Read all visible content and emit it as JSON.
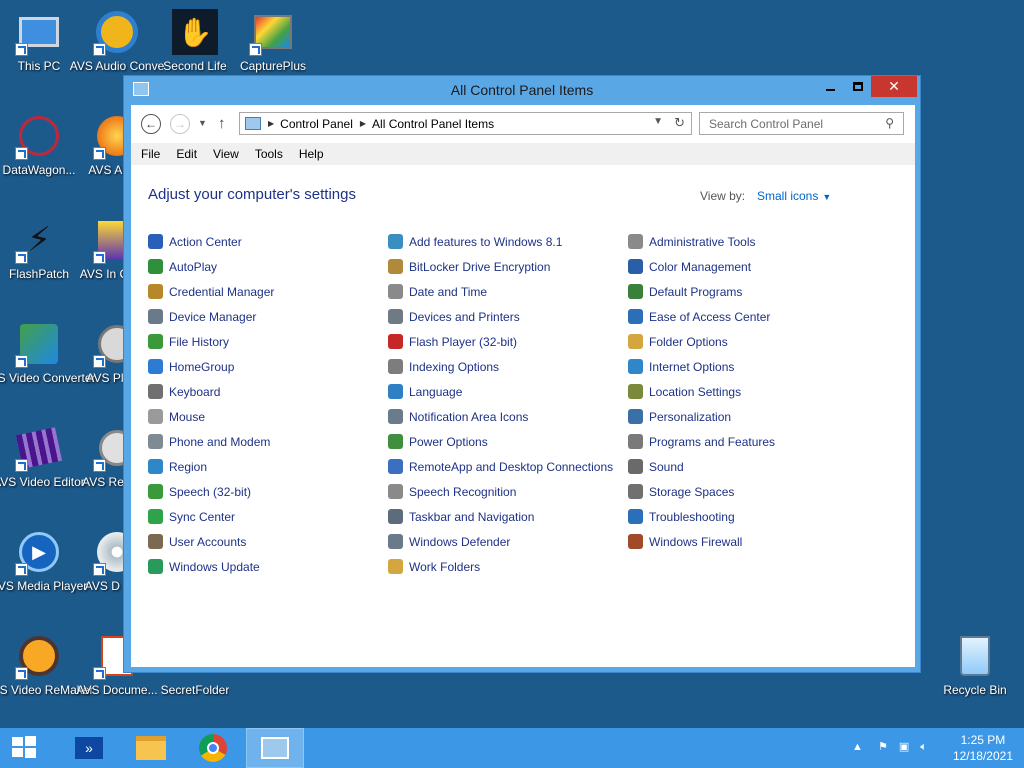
{
  "desktop": {
    "icons": [
      {
        "label": "This PC",
        "icon": "computer-icon"
      },
      {
        "label": "AVS Audio Conve",
        "icon": "avs-audio-converter-icon"
      },
      {
        "label": "Second Life",
        "icon": "second-life-icon"
      },
      {
        "label": "CapturePlus",
        "icon": "captureplus-icon"
      },
      {
        "label": "DataWagon...",
        "icon": "datawagon-icon"
      },
      {
        "label": "AVS A Edit",
        "icon": "avs-audio-editor-icon"
      },
      {
        "label": "FlashPatch",
        "icon": "flashpatch-icon"
      },
      {
        "label": "AVS In Conve",
        "icon": "avs-image-converter-icon"
      },
      {
        "label": "AVS Video Converter",
        "icon": "avs-video-converter-icon"
      },
      {
        "label": "AVS Pl Edit",
        "icon": "avs-photo-editor-icon"
      },
      {
        "label": "AVS Video Editor",
        "icon": "avs-video-editor-icon"
      },
      {
        "label": "AVS Re Clea",
        "icon": "avs-registry-cleaner-icon"
      },
      {
        "label": "AVS Media Player",
        "icon": "avs-media-player-icon"
      },
      {
        "label": "AVS D Crea",
        "icon": "avs-disc-creator-icon"
      },
      {
        "label": "AVS Video ReMaker",
        "icon": "avs-video-remaker-icon"
      },
      {
        "label": "AVS Docume...",
        "icon": "avs-document-converter-icon"
      },
      {
        "label": "SecretFolder",
        "icon": "secretfolder-icon"
      },
      {
        "label": "Recycle Bin",
        "icon": "recycle-bin-icon"
      }
    ]
  },
  "window": {
    "title": "All Control Panel Items",
    "address": [
      "Control Panel",
      "All Control Panel Items"
    ],
    "search_placeholder": "Search Control Panel",
    "menu": [
      "File",
      "Edit",
      "View",
      "Tools",
      "Help"
    ],
    "heading": "Adjust your computer's settings",
    "view_by_label": "View by:",
    "view_by_value": "Small icons",
    "columns": [
      [
        {
          "label": "Action Center",
          "color": "#2a5fb8"
        },
        {
          "label": "AutoPlay",
          "color": "#2f8f3a"
        },
        {
          "label": "Credential Manager",
          "color": "#b8872a"
        },
        {
          "label": "Device Manager",
          "color": "#6b7a8a"
        },
        {
          "label": "File History",
          "color": "#3a9a3a"
        },
        {
          "label": "HomeGroup",
          "color": "#2e7bd3"
        },
        {
          "label": "Keyboard",
          "color": "#707070"
        },
        {
          "label": "Mouse",
          "color": "#9a9a9a"
        },
        {
          "label": "Phone and Modem",
          "color": "#808a94"
        },
        {
          "label": "Region",
          "color": "#2f86c8"
        },
        {
          "label": "Speech (32-bit)",
          "color": "#3a9a3a"
        },
        {
          "label": "Sync Center",
          "color": "#2ea34a"
        },
        {
          "label": "User Accounts",
          "color": "#7a6a52"
        },
        {
          "label": "Windows Update",
          "color": "#2a9a5a"
        }
      ],
      [
        {
          "label": "Add features to Windows 8.1",
          "color": "#3a8fc0"
        },
        {
          "label": "BitLocker Drive Encryption",
          "color": "#b08a3a"
        },
        {
          "label": "Date and Time",
          "color": "#8a8a8a"
        },
        {
          "label": "Devices and Printers",
          "color": "#707a84"
        },
        {
          "label": "Flash Player (32-bit)",
          "color": "#c62828"
        },
        {
          "label": "Indexing Options",
          "color": "#7d7d7d"
        },
        {
          "label": "Language",
          "color": "#2f7fc4"
        },
        {
          "label": "Notification Area Icons",
          "color": "#6a7b8c"
        },
        {
          "label": "Power Options",
          "color": "#3f8f3f"
        },
        {
          "label": "RemoteApp and Desktop Connections",
          "color": "#3b6fc0"
        },
        {
          "label": "Speech Recognition",
          "color": "#8a8a8a"
        },
        {
          "label": "Taskbar and Navigation",
          "color": "#5c6c7c"
        },
        {
          "label": "Windows Defender",
          "color": "#6a7a8a"
        },
        {
          "label": "Work Folders",
          "color": "#d4a640"
        }
      ],
      [
        {
          "label": "Administrative Tools",
          "color": "#8a8a8a"
        },
        {
          "label": "Color Management",
          "color": "#2a5fa8"
        },
        {
          "label": "Default Programs",
          "color": "#3a7f3a"
        },
        {
          "label": "Ease of Access Center",
          "color": "#2a6fb8"
        },
        {
          "label": "Folder Options",
          "color": "#d4a640"
        },
        {
          "label": "Internet Options",
          "color": "#2f86c8"
        },
        {
          "label": "Location Settings",
          "color": "#7a8a3a"
        },
        {
          "label": "Personalization",
          "color": "#3a6fa8"
        },
        {
          "label": "Programs and Features",
          "color": "#7a7a7a"
        },
        {
          "label": "Sound",
          "color": "#6a6a6a"
        },
        {
          "label": "Storage Spaces",
          "color": "#707070"
        },
        {
          "label": "Troubleshooting",
          "color": "#2a6fb8"
        },
        {
          "label": "Windows Firewall",
          "color": "#a04a2a"
        }
      ]
    ]
  },
  "taskbar": {
    "apps": [
      "start-button",
      "powershell-icon",
      "file-explorer-icon",
      "chrome-icon",
      "control-panel-icon"
    ],
    "time": "1:25 PM",
    "date": "12/18/2021"
  }
}
